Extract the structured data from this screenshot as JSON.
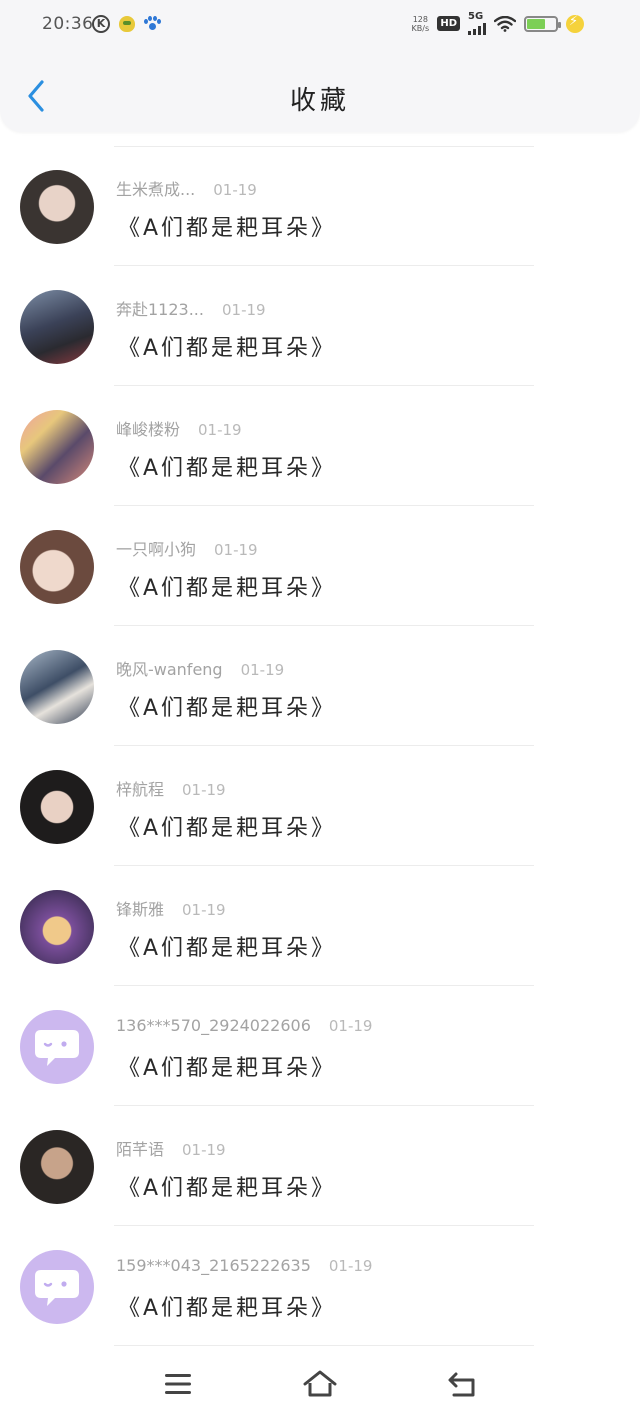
{
  "status_bar": {
    "time": "20:36",
    "net_speed_value": "128",
    "net_speed_unit": "KB/s",
    "hd_label": "HD",
    "network_label": "5G",
    "battery_level": 0.6,
    "colors": {
      "battery": "#7ccf56",
      "charge": "#f5d23c"
    }
  },
  "nav": {
    "back_icon": "chevron-left-icon",
    "title": "收藏",
    "accent": "#2b8fe0"
  },
  "items": [
    {
      "user": "生米煮成...",
      "date": "01-19",
      "content": "《A们都是耙耳朵》",
      "avatar": "photo"
    },
    {
      "user": "奔赴1123...",
      "date": "01-19",
      "content": "《A们都是耙耳朵》",
      "avatar": "photo"
    },
    {
      "user": "峰峻楼粉",
      "date": "01-19",
      "content": "《A们都是耙耳朵》",
      "avatar": "photo"
    },
    {
      "user": "一只啊小狗",
      "date": "01-19",
      "content": "《A们都是耙耳朵》",
      "avatar": "photo"
    },
    {
      "user": "晚风-wanfeng",
      "date": "01-19",
      "content": "《A们都是耙耳朵》",
      "avatar": "photo"
    },
    {
      "user": "梓航程",
      "date": "01-19",
      "content": "《A们都是耙耳朵》",
      "avatar": "photo"
    },
    {
      "user": "锋斯雅",
      "date": "01-19",
      "content": "《A们都是耙耳朵》",
      "avatar": "photo"
    },
    {
      "user": "136***570_2924022606",
      "date": "01-19",
      "content": "《A们都是耙耳朵》",
      "avatar": "default"
    },
    {
      "user": "陌芊语",
      "date": "01-19",
      "content": "《A们都是耙耳朵》",
      "avatar": "photo"
    },
    {
      "user": "159***043_2165222635",
      "date": "01-19",
      "content": "《A们都是耙耳朵》",
      "avatar": "default"
    }
  ],
  "system_nav": {
    "menu_icon": "menu-icon",
    "home_icon": "home-icon",
    "back_icon": "back-icon"
  }
}
